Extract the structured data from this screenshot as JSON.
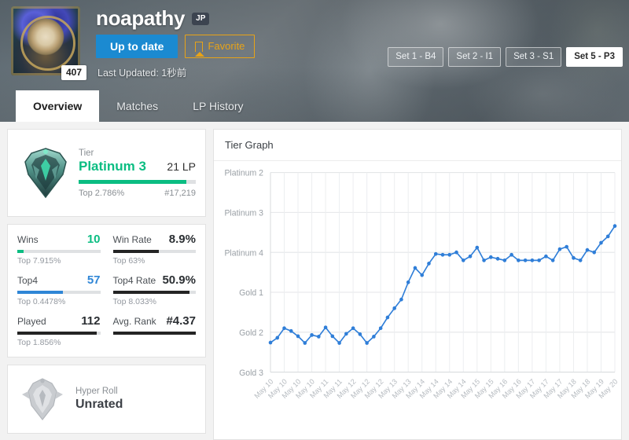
{
  "header": {
    "summoner_name": "noapathy",
    "region_tag": "JP",
    "avatar_level": "407",
    "update_button": "Up to date",
    "favorite_button": "Favorite",
    "last_updated": "Last Updated: 1秒前",
    "set_buttons": [
      {
        "label": "Set 1 - B4",
        "active": false
      },
      {
        "label": "Set 2 - I1",
        "active": false
      },
      {
        "label": "Set 3 - S1",
        "active": false
      },
      {
        "label": "Set 5 - P3",
        "active": true
      }
    ],
    "tabs": [
      {
        "label": "Overview",
        "active": true
      },
      {
        "label": "Matches",
        "active": false
      },
      {
        "label": "LP History",
        "active": false
      }
    ]
  },
  "tier_card": {
    "label": "Tier",
    "tier": "Platinum 3",
    "lp": "21 LP",
    "top_percent": "Top 2.786%",
    "rank": "#17,219",
    "progress": 92,
    "accent": "#0bbd82"
  },
  "stats": [
    {
      "name": "Wins",
      "value": "10",
      "sub": "Top 7.915%",
      "bar": 8,
      "color": "#0bbd82",
      "value_class": "green"
    },
    {
      "name": "Win Rate",
      "value": "8.9%",
      "sub": "Top 63%",
      "bar": 55,
      "color": "#242424",
      "value_class": ""
    },
    {
      "name": "Top4",
      "value": "57",
      "sub": "Top 0.4478%",
      "bar": 55,
      "color": "#2f86d6",
      "value_class": "blue"
    },
    {
      "name": "Top4 Rate",
      "value": "50.9%",
      "sub": "Top 8.033%",
      "bar": 92,
      "color": "#242424",
      "value_class": ""
    },
    {
      "name": "Played",
      "value": "112",
      "sub": "Top 1.856%",
      "bar": 96,
      "color": "#242424",
      "value_class": ""
    },
    {
      "name": "Avg. Rank",
      "value": "#4.37",
      "sub": "",
      "bar": 100,
      "color": "#242424",
      "value_class": ""
    }
  ],
  "hyper_roll": {
    "label": "Hyper Roll",
    "value": "Unrated"
  },
  "chart_data": {
    "type": "line",
    "title": "Tier Graph",
    "xlabel": "",
    "ylabel": "",
    "grid": true,
    "legend": "none",
    "series_color": "#2f7ed8",
    "ytick_labels": [
      "Platinum 2",
      "Platinum 3",
      "Platinum 4",
      "Gold 1",
      "Gold 2",
      "Gold 3"
    ],
    "ytick_values": [
      5,
      4,
      3,
      2,
      1,
      0
    ],
    "ylim": [
      0,
      5
    ],
    "x": [
      "May 10",
      "May 10",
      "May 10",
      "May 10",
      "May 11",
      "May 11",
      "May 12",
      "May 12",
      "May 12",
      "May 13",
      "May 13",
      "May 14",
      "May 14",
      "May 14",
      "May 14",
      "May 15",
      "May 15",
      "May 16",
      "May 16",
      "May 17",
      "May 17",
      "May 17",
      "May 18",
      "May 18",
      "May 19",
      "May 20"
    ],
    "categories": [
      "May 10",
      "May 10",
      "May 10",
      "May 10",
      "May 11",
      "May 11",
      "May 12",
      "May 12",
      "May 12",
      "May 13",
      "May 13",
      "May 14",
      "May 14",
      "May 14",
      "May 14",
      "May 15",
      "May 15",
      "May 16",
      "May 16",
      "May 17",
      "May 17",
      "May 17",
      "May 18",
      "May 18",
      "May 19",
      "May 20"
    ],
    "values": [
      0.74,
      0.86,
      1.1,
      1.03,
      0.9,
      0.73,
      0.93,
      0.89,
      1.12,
      0.9,
      0.73,
      0.96,
      1.1,
      0.95,
      0.73,
      0.89,
      1.1,
      1.37,
      1.6,
      1.82,
      2.25,
      2.61,
      2.43,
      2.72,
      2.96,
      2.94,
      2.94,
      3.0,
      2.8,
      2.9,
      3.12,
      2.8,
      2.88,
      2.84,
      2.8,
      2.94,
      2.8,
      2.8,
      2.8,
      2.8,
      2.9,
      2.8,
      3.08,
      3.14,
      2.86,
      2.8,
      3.06,
      3.0,
      3.24,
      3.4,
      3.66
    ],
    "values_full": [
      0.74,
      0.86,
      1.1,
      1.03,
      0.9,
      0.73,
      0.93,
      0.89,
      1.12,
      0.9,
      0.73,
      0.96,
      1.1,
      0.95,
      0.73,
      0.89,
      1.1,
      1.37,
      1.6,
      1.82,
      2.25,
      2.61,
      2.43,
      2.72,
      2.96,
      2.94,
      2.94,
      3.0,
      2.8,
      2.9,
      3.12,
      2.8,
      2.88,
      2.84,
      2.8,
      2.94,
      2.8,
      2.8,
      2.8,
      2.8,
      2.9,
      2.8,
      3.08,
      3.14,
      2.86,
      2.8,
      3.06,
      3.0,
      3.24,
      3.4,
      3.66
    ],
    "n_points": 51,
    "n_xticks": 26,
    "description": "Tier rating over time rising from Gold 2 to Platinum 3"
  }
}
